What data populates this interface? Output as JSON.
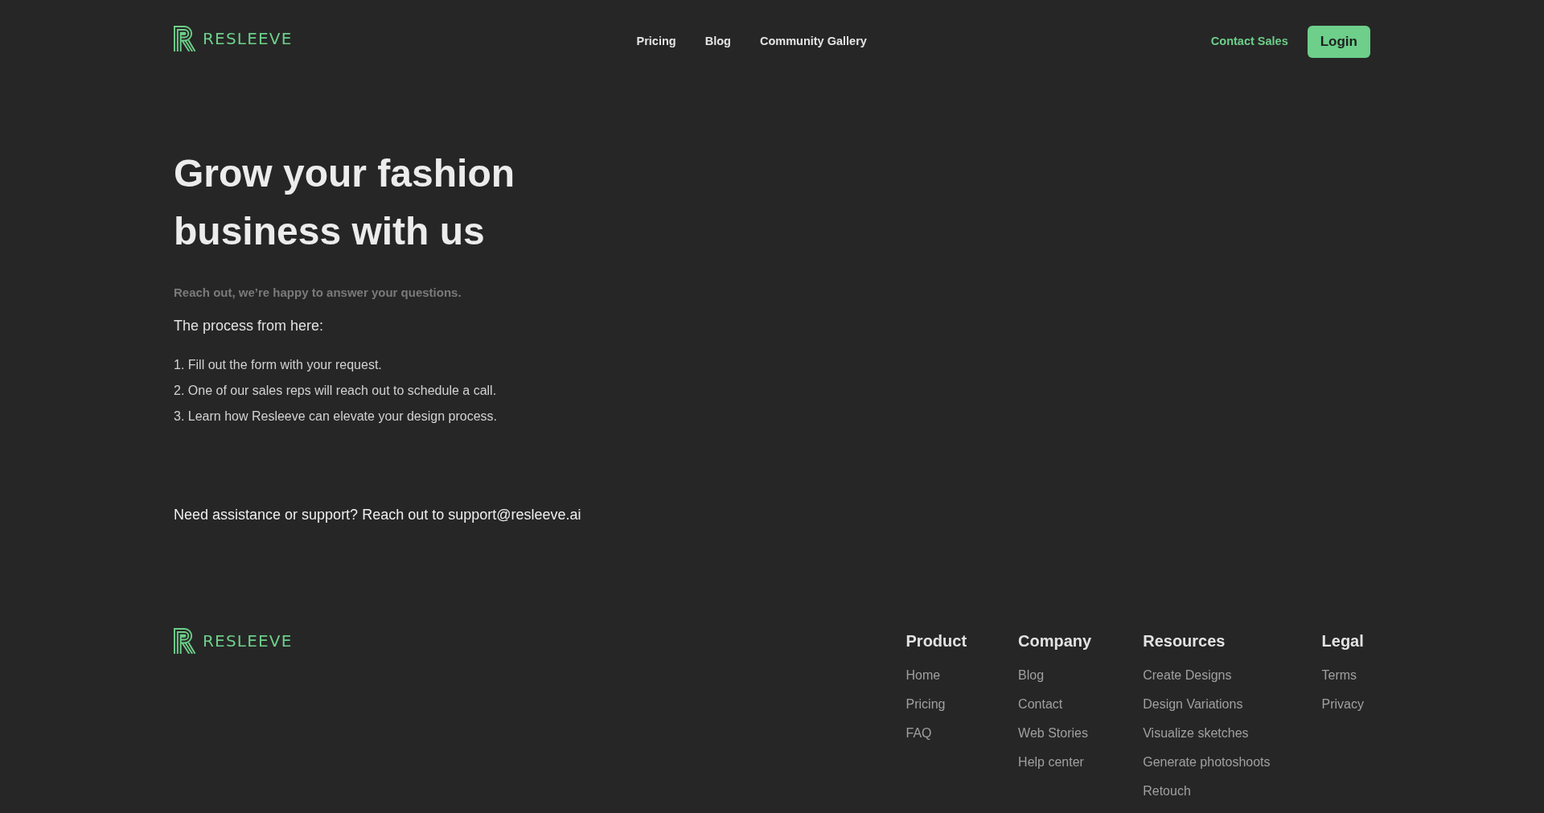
{
  "header": {
    "brand": "RESLEEVE",
    "nav": [
      "Pricing",
      "Blog",
      "Community Gallery"
    ],
    "contact_link": "Contact Sales",
    "login_button": "Login"
  },
  "hero": {
    "title": "Grow your fashion business with us",
    "subtitle": "Reach out, we’re happy to answer your questions.",
    "process_intro": "The process from here:",
    "steps": [
      "1. Fill out the form with your request.",
      "2. One of our sales reps will reach out to schedule a call.",
      "3. Learn how Resleeve can elevate your design process."
    ],
    "support_text": "Need assistance or support? Reach out to support@resleeve.ai"
  },
  "footer": {
    "brand": "RESLEEVE",
    "columns": [
      {
        "heading": "Product",
        "links": [
          "Home",
          "Pricing",
          "FAQ"
        ]
      },
      {
        "heading": "Company",
        "links": [
          "Blog",
          "Contact",
          "Web Stories",
          "Help center"
        ]
      },
      {
        "heading": "Resources",
        "links": [
          "Create Designs",
          "Design Variations",
          "Visualize sketches",
          "Generate photoshoots",
          "Retouch"
        ]
      },
      {
        "heading": "Legal",
        "links": [
          "Terms",
          "Privacy"
        ]
      }
    ]
  }
}
